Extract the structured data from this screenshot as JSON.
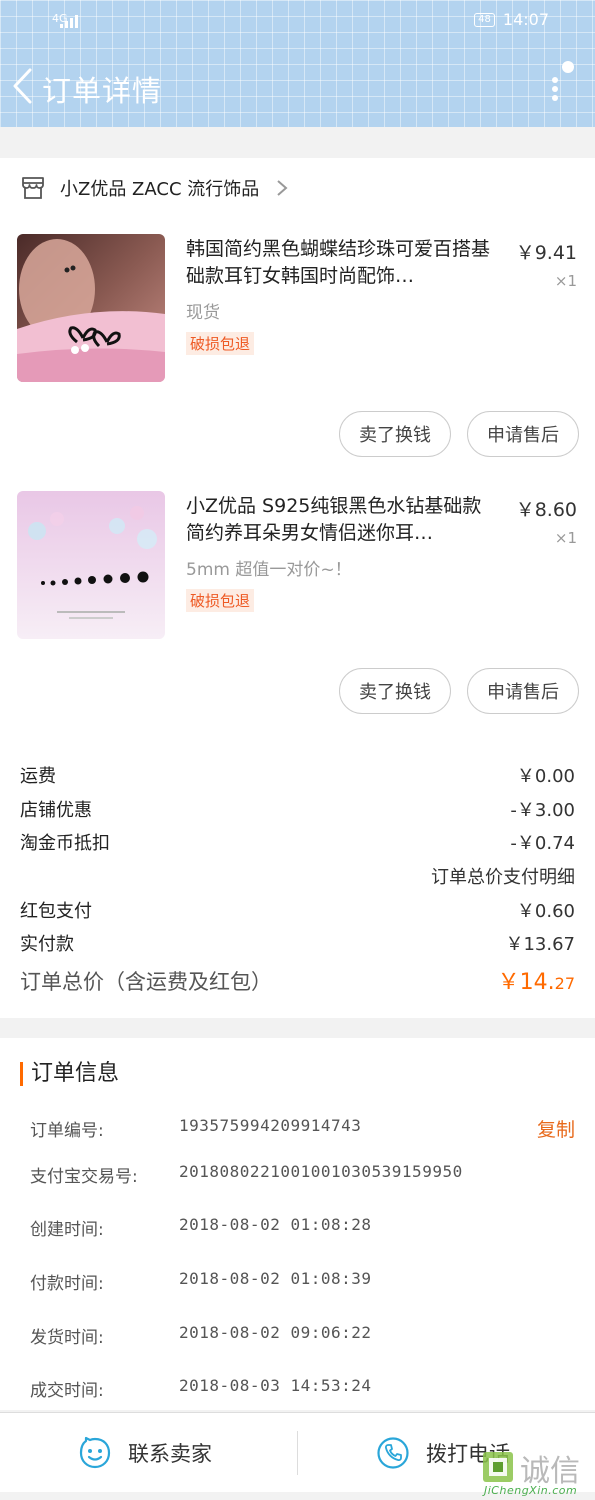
{
  "status_bar": {
    "network": "4G",
    "battery": "48",
    "time": "14:07"
  },
  "header": {
    "title": "订单详情"
  },
  "shop": {
    "name": "小Z优品 ZACC 流行饰品"
  },
  "items": [
    {
      "title": "韩国简约黑色蝴蝶结珍珠可爱百搭基础款耳钉女韩国时尚配饰…",
      "price": "￥9.41",
      "qty": "×1",
      "sku": "现货",
      "badge": "破损包退",
      "btn_sell": "卖了换钱",
      "btn_aftersale": "申请售后"
    },
    {
      "title": "小Z优品 S925纯银黑色水钻基础款简约养耳朵男女情侣迷你耳…",
      "price": "￥8.60",
      "qty": "×1",
      "sku": "5mm 超值一对价~！",
      "badge": "破损包退",
      "btn_sell": "卖了换钱",
      "btn_aftersale": "申请售后"
    }
  ],
  "fees": {
    "shipping_label": "运费",
    "shipping_value": "￥0.00",
    "shop_discount_label": "店铺优惠",
    "shop_discount_value": "-￥3.00",
    "coin_label": "淘金币抵扣",
    "coin_value": "-￥0.74",
    "detail_link": "订单总价支付明细",
    "redpacket_label": "红包支付",
    "redpacket_value": "￥0.60",
    "paid_label": "实付款",
    "paid_value": "￥13.67",
    "total_label": "订单总价（含运费及红包）",
    "total_currency": "￥",
    "total_integer": "14.",
    "total_decimal": "27"
  },
  "order_info": {
    "title": "订单信息",
    "copy_label": "复制",
    "rows": [
      {
        "label": "订单编号:",
        "value": "193575994209914743"
      },
      {
        "label": "支付宝交易号:",
        "value": "2018080221001001030539159950"
      },
      {
        "label": "创建时间:",
        "value": "2018-08-02 01:08:28"
      },
      {
        "label": "付款时间:",
        "value": "2018-08-02 01:08:39"
      },
      {
        "label": "发货时间:",
        "value": "2018-08-02 09:06:22"
      },
      {
        "label": "成交时间:",
        "value": "2018-08-03 14:53:24"
      }
    ]
  },
  "bottom": {
    "contact_seller": "联系卖家",
    "call_phone": "拨打电话"
  },
  "watermark": {
    "main": "诚信",
    "sub": "JiChengXin.com"
  },
  "colors": {
    "accent": "#ff6a00",
    "header_bg": "#b3d3ef",
    "icon_blue": "#2aa6d9"
  }
}
